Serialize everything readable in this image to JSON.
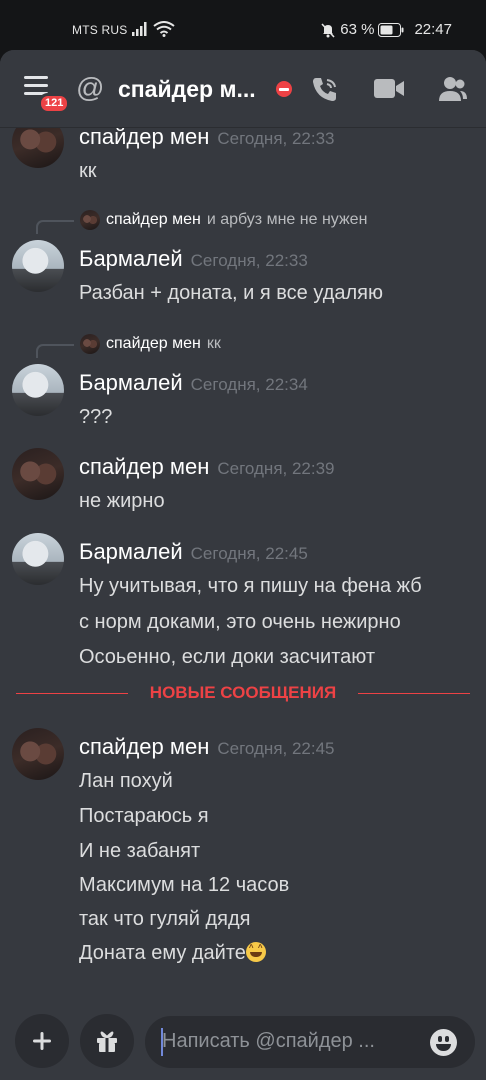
{
  "status_bar": {
    "carrier": "MTS RUS",
    "battery": "63 %",
    "time": "22:47"
  },
  "header": {
    "menu_badge": "121",
    "title": "спайдер м...",
    "at_symbol": "@"
  },
  "messages": [
    {
      "author": "спайдер мен",
      "time": "Сегодня, 22:33",
      "lines": [
        "кк"
      ]
    },
    {
      "reply": {
        "author": "спайдер мен",
        "text": "и арбуз мне не нужен"
      },
      "author": "Бармалей",
      "time": "Сегодня, 22:33",
      "lines": [
        "Разбан + доната, и я все удаляю"
      ]
    },
    {
      "reply": {
        "author": "спайдер мен",
        "text": "кк"
      },
      "author": "Бармалей",
      "time": "Сегодня, 22:34",
      "lines": [
        "???"
      ]
    },
    {
      "author": "спайдер мен",
      "time": "Сегодня, 22:39",
      "lines": [
        "не жирно"
      ]
    },
    {
      "author": "Бармалей",
      "time": "Сегодня, 22:45",
      "lines": [
        "Ну учитывая, что я пишу на фена жб",
        "с норм доками, это очень нежирно",
        "Осоьенно, если доки засчитают"
      ]
    },
    {
      "author": "спайдер мен",
      "time": "Сегодня, 22:45",
      "lines": [
        "Лан похуй",
        "Постараюсь я",
        "И не забанят",
        "Максимум на 12 часов",
        "так что гуляй дядя",
        "Доната ему дайте"
      ]
    }
  ],
  "divider": {
    "label": "НОВЫЕ СООБЩЕНИЯ"
  },
  "composer": {
    "placeholder": "Написать @спайдер ..."
  },
  "colors": {
    "background": "#36393f",
    "new_messages": "#ed4245",
    "badge": "#ed4245",
    "timestamp": "#72767d"
  },
  "icons": [
    "menu-icon",
    "at-icon",
    "dnd-status-icon",
    "phone-call-icon",
    "video-camera-icon",
    "members-icon",
    "plus-icon",
    "gift-icon",
    "emoji-icon"
  ]
}
